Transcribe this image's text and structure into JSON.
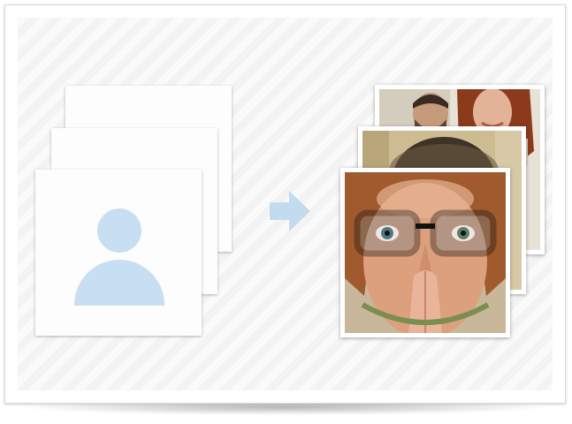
{
  "colors": {
    "avatar_fill": "#c8def2",
    "arrow_fill": "#c3dbef",
    "panel_background": "#f3f3f3"
  },
  "placeholders": {
    "count": 3,
    "icon": "user-silhouette-icon"
  },
  "transition": {
    "icon": "right-arrow-icon"
  },
  "photos": {
    "count": 3,
    "subjects": [
      "couple-photo",
      "short-hair-person-photo",
      "woman-with-glasses-photo"
    ]
  }
}
